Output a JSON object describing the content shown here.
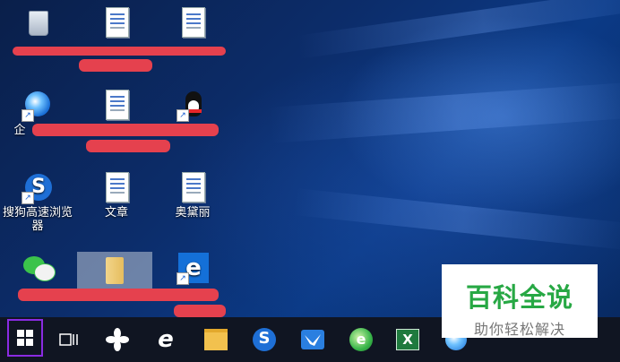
{
  "desktop": {
    "icons": [
      {
        "name": "recycle-bin",
        "label": ""
      },
      {
        "name": "doc-1",
        "label": ""
      },
      {
        "name": "doc-2",
        "label": ""
      },
      {
        "name": "enterprise-app",
        "label": "企"
      },
      {
        "name": "doc-3",
        "label": ""
      },
      {
        "name": "qq",
        "label": ""
      },
      {
        "name": "sogou-browser",
        "label": "搜狗高速浏览器"
      },
      {
        "name": "doc-wenzhang",
        "label": "文章"
      },
      {
        "name": "doc-aodaili",
        "label": "奥黛丽"
      },
      {
        "name": "wechat",
        "label": ""
      },
      {
        "name": "folder",
        "label": ""
      },
      {
        "name": "edge",
        "label": ""
      }
    ]
  },
  "taskbar": {
    "items": [
      "start",
      "task-view",
      "fan-app",
      "ie",
      "file-explorer",
      "sogou",
      "feishu",
      "360-browser",
      "excel",
      "browser"
    ]
  },
  "watermark": {
    "title": "百科全说",
    "subtitle": "助你轻松解决"
  },
  "colors": {
    "accent": "#27a844",
    "redact": "#e5414e",
    "start_outline": "#8a2be2"
  }
}
